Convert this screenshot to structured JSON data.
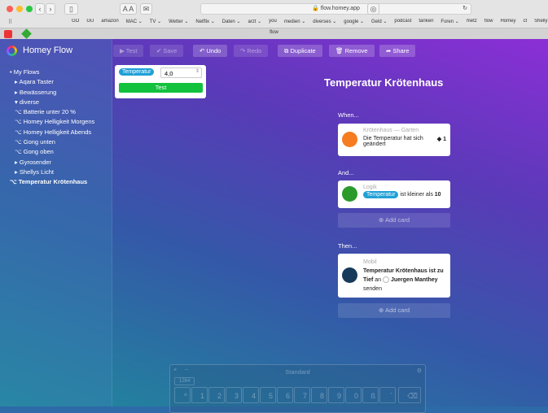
{
  "browser": {
    "url": "flow.homey.app",
    "tab_title": "flow",
    "font_small": "A",
    "font_large": "A",
    "bookmarks": [
      "GO",
      "GU",
      "amazon",
      "MAC ⌄",
      "TV ⌄",
      "Wetter ⌄",
      "Netflix ⌄",
      "Daten ⌄",
      "arzt ⌄",
      "you",
      "medien ⌄",
      "diverses ⌄",
      "google ⌄",
      "Geld ⌄",
      "podcast",
      "tanken",
      "Foren ⌄",
      "metz",
      "flow",
      "Homey",
      "ct",
      "Shelly"
    ]
  },
  "app": {
    "title": "Homey Flow"
  },
  "toolbar": {
    "test": "Test",
    "save": "Save",
    "undo": "Undo",
    "redo": "Redo",
    "duplicate": "Duplicate",
    "remove": "Remove",
    "share": "Share"
  },
  "test_popup": {
    "token": "Temperatur",
    "value": "4,0",
    "button": "Test"
  },
  "sidebar": {
    "root": "My Flows",
    "items": [
      {
        "label": "Aqara Taster",
        "type": "folder"
      },
      {
        "label": "Bewässerung",
        "type": "folder"
      },
      {
        "label": "diverse",
        "type": "folder-open"
      },
      {
        "label": "Batterie unter 20 %",
        "type": "flow"
      },
      {
        "label": "Homey Helligkeit Morgens",
        "type": "flow"
      },
      {
        "label": "Homey Helligkeit Abends",
        "type": "flow"
      },
      {
        "label": "Gong unten",
        "type": "flow"
      },
      {
        "label": "Gong oben",
        "type": "flow"
      },
      {
        "label": "Gyrosender",
        "type": "folder"
      },
      {
        "label": "Shellys Licht",
        "type": "folder"
      },
      {
        "label": "Temperatur Krötenhaus",
        "type": "flow-active"
      }
    ]
  },
  "flow": {
    "title": "Temperatur Krötenhaus",
    "when": {
      "heading": "When...",
      "source": "Krötenhaus — Garten",
      "text": "Die Temperatur hat sich geändert",
      "token_count": "1",
      "color": "#f57c1f"
    },
    "and": {
      "heading": "And...",
      "source": "Logik",
      "token": "Temperatur",
      "text": "ist kleiner als",
      "value": "10",
      "add": "Add card",
      "color": "#2a9a2a"
    },
    "then": {
      "heading": "Then...",
      "source": "Mobil",
      "text1": "Temperatur Krötenhaus ist zu Tief",
      "an": "an",
      "user": "Juergen Manthey",
      "text2": "senden",
      "add": "Add card",
      "color": "#173a5a"
    }
  },
  "keyboard": {
    "title": "Standard",
    "field": "1264",
    "keys": [
      "^",
      "1",
      "2",
      "3",
      "4",
      "5",
      "6",
      "7",
      "8",
      "9",
      "0",
      "ß",
      "´",
      "⌫"
    ]
  }
}
